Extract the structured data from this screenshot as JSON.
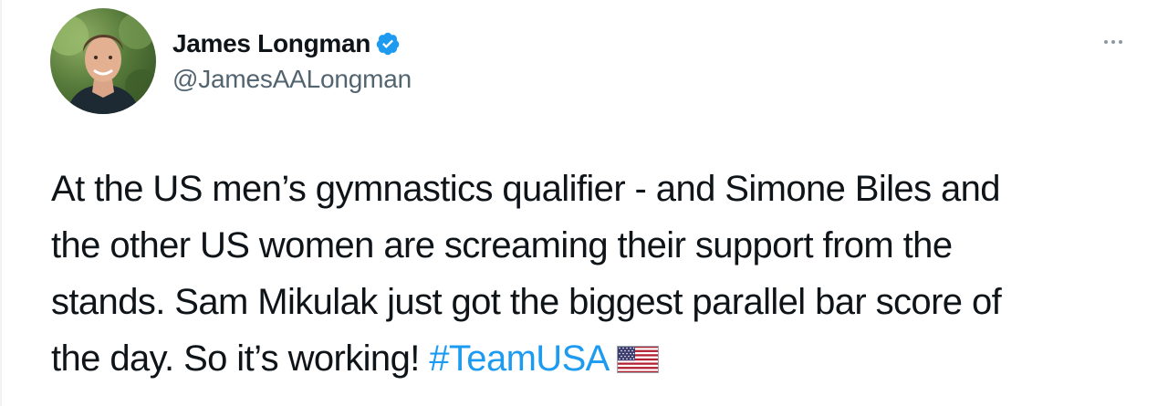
{
  "tweet": {
    "author": {
      "display_name": "James Longman",
      "handle": "@JamesAALongman",
      "verified": true,
      "avatar_icon": "avatar"
    },
    "more_icon": "more-horizontal-icon",
    "text_lines": [
      "At the US men’s gymnastics qualifier  - and Simone Biles and",
      "the other US women are screaming their support from the",
      "stands. Sam Mikulak just got the biggest parallel bar score of",
      "the day. So it’s working! "
    ],
    "hashtag": "#TeamUSA",
    "emoji_icon": "us-flag-icon",
    "colors": {
      "text": "#0f1419",
      "secondary": "#536471",
      "link": "#1d9bf0",
      "verified": "#1d9bf0"
    }
  }
}
